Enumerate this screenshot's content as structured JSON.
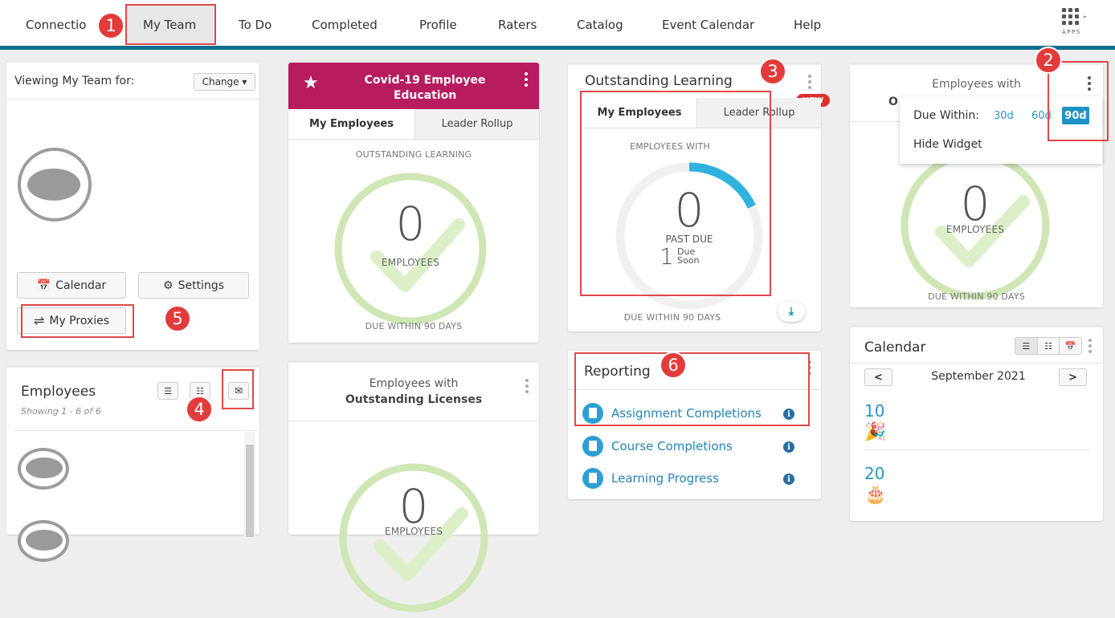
{
  "nav": {
    "items": [
      "Connectio",
      "My Team",
      "To Do",
      "Completed",
      "Profile",
      "Raters",
      "Catalog",
      "Event Calendar",
      "Help"
    ],
    "apps_label": "APPS"
  },
  "callouts": [
    "1",
    "2",
    "3",
    "4",
    "5",
    "6"
  ],
  "viewing": {
    "label": "Viewing My Team for:",
    "change_label": "Change ▾",
    "calendar_btn": "Calendar",
    "settings_btn": "Settings",
    "proxies_btn": "My Proxies"
  },
  "employees": {
    "title": "Employees",
    "showing": "Showing 1 - 6 of 6"
  },
  "covid": {
    "title_line1": "Covid-19 Employee",
    "title_line2": "Education",
    "tabs": [
      "My Employees",
      "Leader Rollup"
    ],
    "caption_top": "OUTSTANDING LEARNING",
    "count": "0",
    "count_label": "EMPLOYEES",
    "caption_bottom": "DUE WITHIN 90 DAYS"
  },
  "licenses": {
    "title_line1": "Employees with",
    "title_line2": "Outstanding Licenses",
    "count": "0",
    "count_label": "EMPLOYEES"
  },
  "outstanding": {
    "title": "Outstanding Learning",
    "new_badge": "NEW",
    "tabs": [
      "My Employees",
      "Leader Rollup"
    ],
    "caption_top": "EMPLOYEES WITH",
    "count": "0",
    "past_due_label": "PAST DUE",
    "due_soon_count": "1",
    "due_soon_line1": "Due",
    "due_soon_line2": "Soon",
    "due_soon_fraction": 0.18,
    "caption_bottom": "DUE WITHIN 90 DAYS"
  },
  "reporting": {
    "title": "Reporting",
    "items": [
      "Assignment Completions",
      "Course Completions",
      "Learning Progress"
    ],
    "info_glyph": "i"
  },
  "widget4": {
    "title_line1": "Employees with",
    "title_partial": "O",
    "menu_due_label": "Due Within:",
    "menu_options": [
      "30d",
      "60d",
      "90d"
    ],
    "menu_selected": "90d",
    "menu_hide": "Hide Widget",
    "count": "0",
    "count_label": "EMPLOYEES",
    "caption_bottom": "DUE WITHIN 90 DAYS"
  },
  "calendar": {
    "title": "Calendar",
    "prev": "<",
    "next": ">",
    "month": "September 2021",
    "events": [
      {
        "day": "10",
        "icon": "party-popper-icon"
      },
      {
        "day": "20",
        "icon": "birthday-cake-icon"
      }
    ]
  },
  "colors": {
    "nav_accent": "#0e6e8e",
    "covid_header": "#b61c5f",
    "ring_green": "#cfe6b5",
    "ring_blue": "#2fb2de",
    "callout_red": "#e23b3b",
    "link_blue": "#2186b6"
  }
}
